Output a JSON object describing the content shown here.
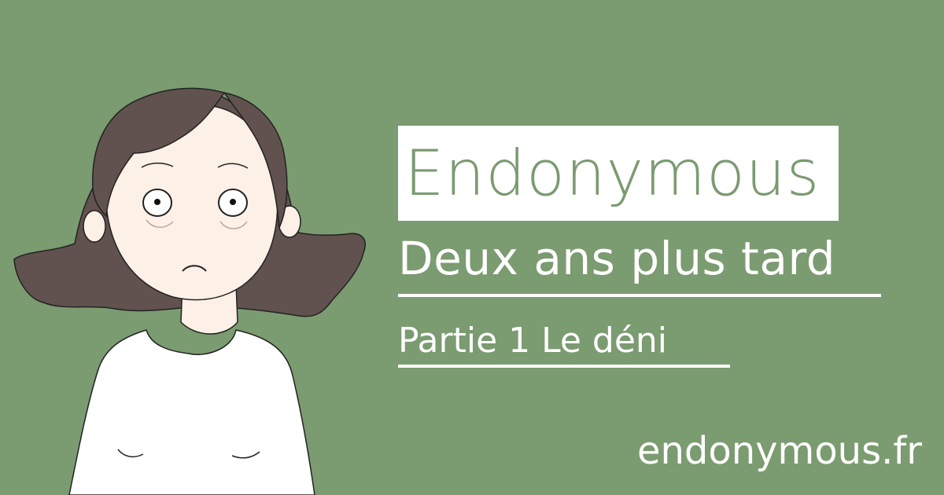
{
  "brand": {
    "title": "Endonymous",
    "website": "endonymous.fr"
  },
  "episode": {
    "subtitle": "Deux ans plus tard",
    "part": "Partie 1 Le déni"
  },
  "colors": {
    "background": "#7b9b71",
    "title_box": "#ffffff",
    "title_text": "#7b9b71",
    "hair": "#61524f",
    "skin": "#fdf0e6",
    "shirt": "#ffffff"
  }
}
